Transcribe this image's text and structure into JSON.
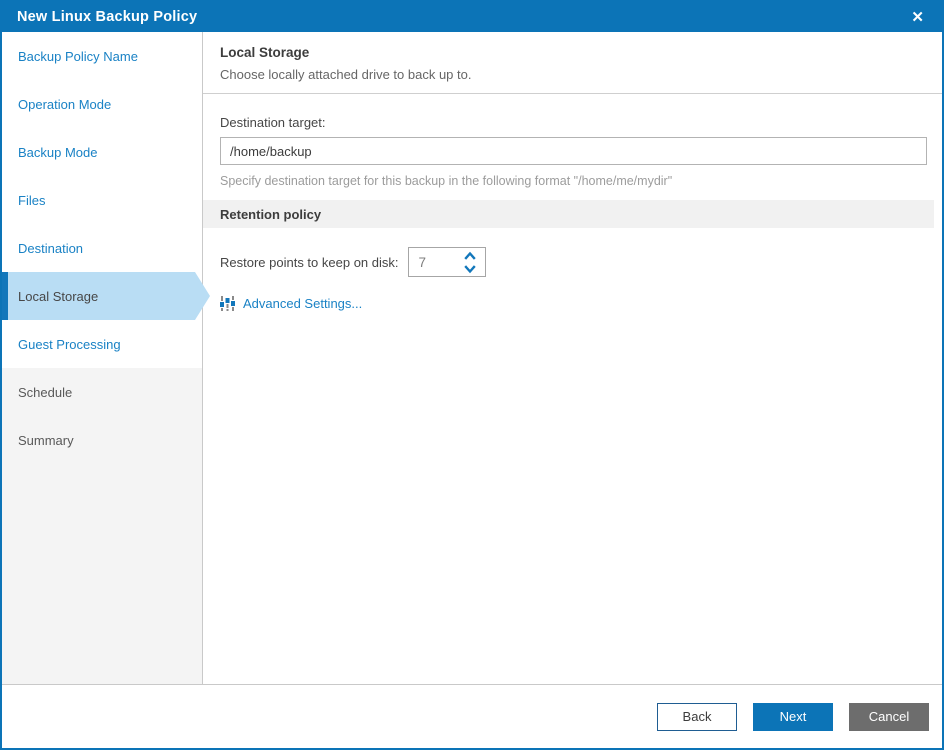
{
  "window": {
    "title": "New Linux Backup Policy",
    "close_glyph": "✕"
  },
  "sidebar": {
    "items": [
      {
        "label": "Backup Policy Name",
        "state": "link"
      },
      {
        "label": "Operation Mode",
        "state": "link"
      },
      {
        "label": "Backup Mode",
        "state": "link"
      },
      {
        "label": "Files",
        "state": "link"
      },
      {
        "label": "Destination",
        "state": "link"
      },
      {
        "label": "Local Storage",
        "state": "current"
      },
      {
        "label": "Guest Processing",
        "state": "link"
      },
      {
        "label": "Schedule",
        "state": "future"
      },
      {
        "label": "Summary",
        "state": "future"
      }
    ]
  },
  "content": {
    "heading": "Local Storage",
    "subheading": "Choose locally attached drive to back up to.",
    "destination": {
      "label": "Destination target:",
      "value": "/home/backup",
      "hint": "Specify destination target for this backup in the following format \"/home/me/mydir\""
    },
    "retention": {
      "header": "Retention policy",
      "restore_points_label": "Restore points to keep on disk:",
      "restore_points_value": "7"
    },
    "advanced_settings_label": "Advanced Settings...",
    "icons": {
      "advanced_settings": "sliders-icon",
      "spin_up": "chevron-up-icon",
      "spin_down": "chevron-down-icon"
    }
  },
  "footer": {
    "back_label": "Back",
    "next_label": "Next",
    "cancel_label": "Cancel"
  },
  "colors": {
    "accent_blue": "#0c74b7",
    "link_blue": "#1a82c5",
    "selected_highlight": "#b9ddf4",
    "selected_stripe": "#1277bb",
    "disabled_bg": "#f4f4f4",
    "section_bar_bg": "#f1f1f1",
    "cancel_gray": "#6d6d6d"
  }
}
